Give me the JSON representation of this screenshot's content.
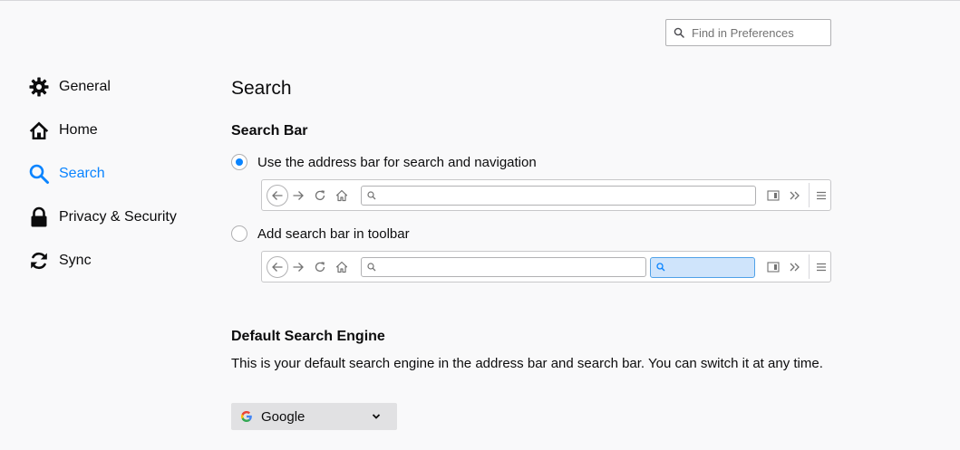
{
  "search": {
    "placeholder": "Find in Preferences"
  },
  "sidebar": {
    "items": [
      {
        "label": "General",
        "icon": "gear-icon"
      },
      {
        "label": "Home",
        "icon": "home-icon"
      },
      {
        "label": "Search",
        "icon": "search-icon",
        "active": true
      },
      {
        "label": "Privacy & Security",
        "icon": "lock-icon"
      },
      {
        "label": "Sync",
        "icon": "sync-icon"
      }
    ]
  },
  "main": {
    "title": "Search",
    "search_bar": {
      "heading": "Search Bar",
      "options": [
        {
          "label": "Use the address bar for search and navigation",
          "selected": true
        },
        {
          "label": "Add search bar in toolbar",
          "selected": false
        }
      ]
    },
    "default_engine": {
      "heading": "Default Search Engine",
      "description": "This is your default search engine in the address bar and search bar. You can switch it at any time.",
      "selected": "Google"
    }
  },
  "colors": {
    "accent": "#0a84ff",
    "background": "#f9f9fa",
    "select_bg": "#e1e1e3",
    "search_highlight": "#cfe4fb"
  }
}
